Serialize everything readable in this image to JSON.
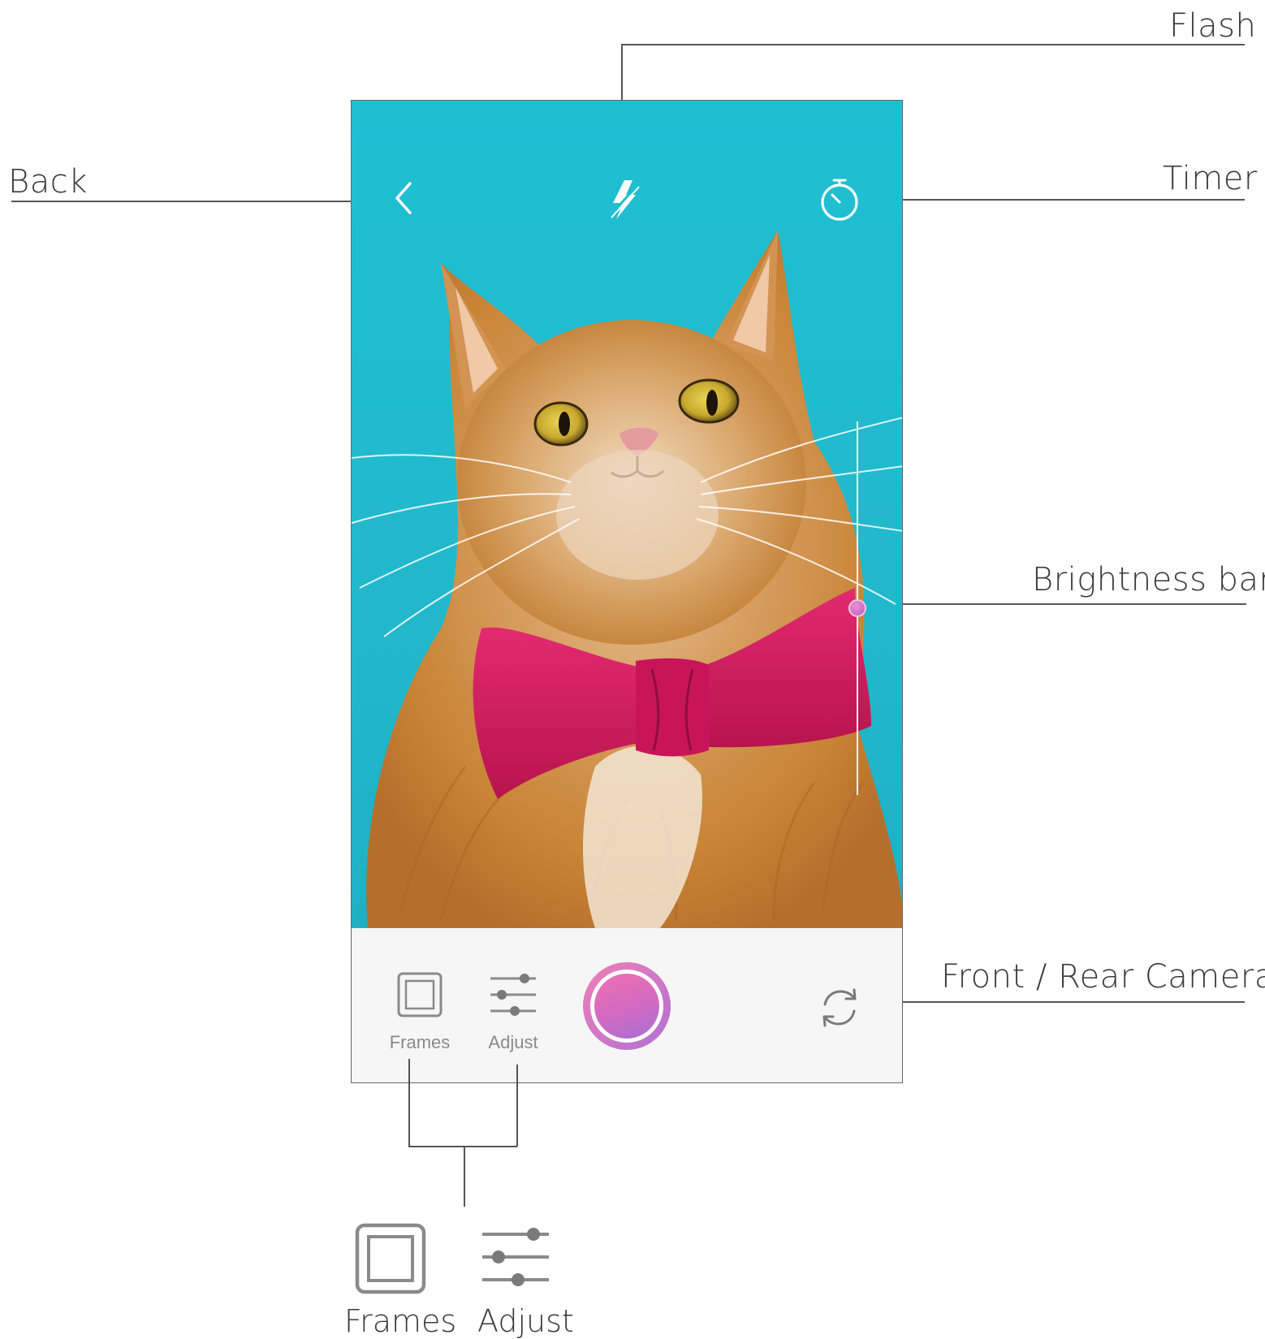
{
  "callouts": {
    "flash": "Flash",
    "back": "Back",
    "timer": "Timer",
    "brightness": "Brightness bar",
    "camera_switch": "Front / Rear Camera"
  },
  "brightness_level": 0.5,
  "bottom_bar": {
    "frames_label": "Frames",
    "adjust_label": "Adjust"
  },
  "legend": {
    "frames_label": "Frames",
    "adjust_label": "Adjust"
  },
  "icons": [
    "back-icon",
    "flash-icon",
    "timer-icon",
    "frames-icon",
    "adjust-icon",
    "shutter-button",
    "camera-switch-icon"
  ],
  "colors": {
    "sky": "#1fbfd2",
    "shutter_pink": "#f070b0",
    "shutter_purple": "#a66fd4",
    "bowtie": "#d9195e"
  }
}
